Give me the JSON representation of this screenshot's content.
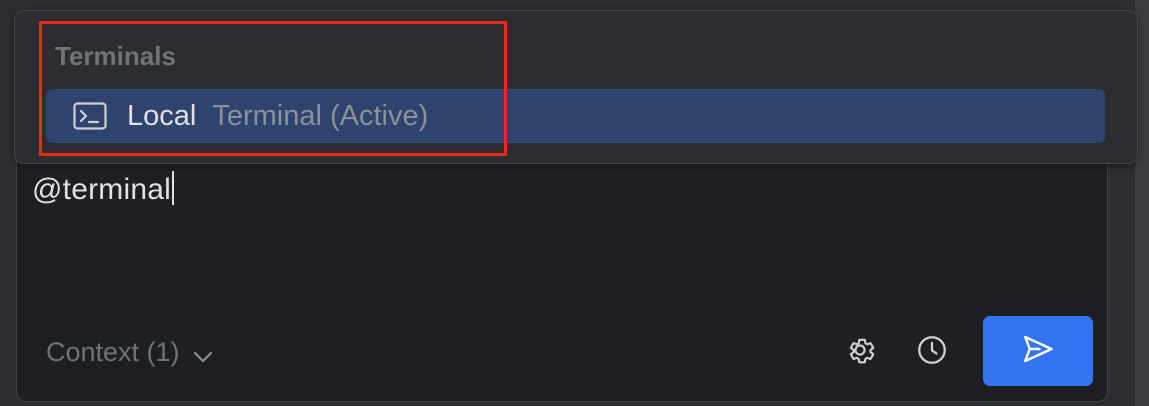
{
  "popup": {
    "section_header": "Terminals",
    "items": [
      {
        "label": "Local",
        "sublabel": "Terminal (Active)",
        "icon": "terminal-icon",
        "selected": true
      }
    ]
  },
  "input": {
    "value": "@terminal"
  },
  "footer": {
    "context_label": "Context (1)",
    "settings_icon": "gear-icon",
    "history_icon": "clock-icon",
    "send_icon": "send-icon"
  },
  "colors": {
    "accent": "#3574f0",
    "selection": "#2e436e",
    "highlight_box": "#e8291c"
  }
}
